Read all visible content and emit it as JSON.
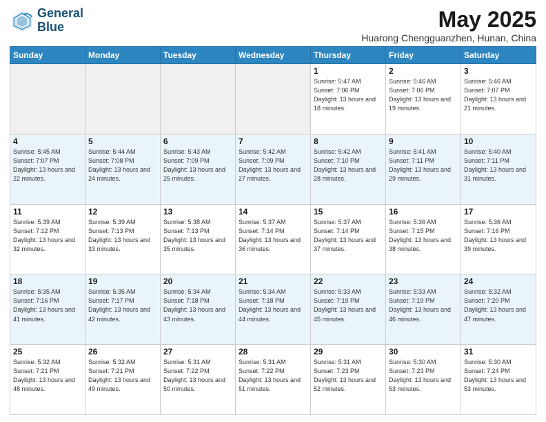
{
  "logo": {
    "line1": "General",
    "line2": "Blue"
  },
  "title": "May 2025",
  "location": "Huarong Chengguanzhen, Hunan, China",
  "weekdays": [
    "Sunday",
    "Monday",
    "Tuesday",
    "Wednesday",
    "Thursday",
    "Friday",
    "Saturday"
  ],
  "weeks": [
    [
      {
        "day": "",
        "info": ""
      },
      {
        "day": "",
        "info": ""
      },
      {
        "day": "",
        "info": ""
      },
      {
        "day": "",
        "info": ""
      },
      {
        "day": "1",
        "info": "Sunrise: 5:47 AM\nSunset: 7:06 PM\nDaylight: 13 hours\nand 18 minutes."
      },
      {
        "day": "2",
        "info": "Sunrise: 5:46 AM\nSunset: 7:06 PM\nDaylight: 13 hours\nand 19 minutes."
      },
      {
        "day": "3",
        "info": "Sunrise: 5:46 AM\nSunset: 7:07 PM\nDaylight: 13 hours\nand 21 minutes."
      }
    ],
    [
      {
        "day": "4",
        "info": "Sunrise: 5:45 AM\nSunset: 7:07 PM\nDaylight: 13 hours\nand 22 minutes."
      },
      {
        "day": "5",
        "info": "Sunrise: 5:44 AM\nSunset: 7:08 PM\nDaylight: 13 hours\nand 24 minutes."
      },
      {
        "day": "6",
        "info": "Sunrise: 5:43 AM\nSunset: 7:09 PM\nDaylight: 13 hours\nand 25 minutes."
      },
      {
        "day": "7",
        "info": "Sunrise: 5:42 AM\nSunset: 7:09 PM\nDaylight: 13 hours\nand 27 minutes."
      },
      {
        "day": "8",
        "info": "Sunrise: 5:42 AM\nSunset: 7:10 PM\nDaylight: 13 hours\nand 28 minutes."
      },
      {
        "day": "9",
        "info": "Sunrise: 5:41 AM\nSunset: 7:11 PM\nDaylight: 13 hours\nand 29 minutes."
      },
      {
        "day": "10",
        "info": "Sunrise: 5:40 AM\nSunset: 7:11 PM\nDaylight: 13 hours\nand 31 minutes."
      }
    ],
    [
      {
        "day": "11",
        "info": "Sunrise: 5:39 AM\nSunset: 7:12 PM\nDaylight: 13 hours\nand 32 minutes."
      },
      {
        "day": "12",
        "info": "Sunrise: 5:39 AM\nSunset: 7:13 PM\nDaylight: 13 hours\nand 33 minutes."
      },
      {
        "day": "13",
        "info": "Sunrise: 5:38 AM\nSunset: 7:13 PM\nDaylight: 13 hours\nand 35 minutes."
      },
      {
        "day": "14",
        "info": "Sunrise: 5:37 AM\nSunset: 7:14 PM\nDaylight: 13 hours\nand 36 minutes."
      },
      {
        "day": "15",
        "info": "Sunrise: 5:37 AM\nSunset: 7:14 PM\nDaylight: 13 hours\nand 37 minutes."
      },
      {
        "day": "16",
        "info": "Sunrise: 5:36 AM\nSunset: 7:15 PM\nDaylight: 13 hours\nand 38 minutes."
      },
      {
        "day": "17",
        "info": "Sunrise: 5:36 AM\nSunset: 7:16 PM\nDaylight: 13 hours\nand 39 minutes."
      }
    ],
    [
      {
        "day": "18",
        "info": "Sunrise: 5:35 AM\nSunset: 7:16 PM\nDaylight: 13 hours\nand 41 minutes."
      },
      {
        "day": "19",
        "info": "Sunrise: 5:35 AM\nSunset: 7:17 PM\nDaylight: 13 hours\nand 42 minutes."
      },
      {
        "day": "20",
        "info": "Sunrise: 5:34 AM\nSunset: 7:18 PM\nDaylight: 13 hours\nand 43 minutes."
      },
      {
        "day": "21",
        "info": "Sunrise: 5:34 AM\nSunset: 7:18 PM\nDaylight: 13 hours\nand 44 minutes."
      },
      {
        "day": "22",
        "info": "Sunrise: 5:33 AM\nSunset: 7:19 PM\nDaylight: 13 hours\nand 45 minutes."
      },
      {
        "day": "23",
        "info": "Sunrise: 5:33 AM\nSunset: 7:19 PM\nDaylight: 13 hours\nand 46 minutes."
      },
      {
        "day": "24",
        "info": "Sunrise: 5:32 AM\nSunset: 7:20 PM\nDaylight: 13 hours\nand 47 minutes."
      }
    ],
    [
      {
        "day": "25",
        "info": "Sunrise: 5:32 AM\nSunset: 7:21 PM\nDaylight: 13 hours\nand 48 minutes."
      },
      {
        "day": "26",
        "info": "Sunrise: 5:32 AM\nSunset: 7:21 PM\nDaylight: 13 hours\nand 49 minutes."
      },
      {
        "day": "27",
        "info": "Sunrise: 5:31 AM\nSunset: 7:22 PM\nDaylight: 13 hours\nand 50 minutes."
      },
      {
        "day": "28",
        "info": "Sunrise: 5:31 AM\nSunset: 7:22 PM\nDaylight: 13 hours\nand 51 minutes."
      },
      {
        "day": "29",
        "info": "Sunrise: 5:31 AM\nSunset: 7:23 PM\nDaylight: 13 hours\nand 52 minutes."
      },
      {
        "day": "30",
        "info": "Sunrise: 5:30 AM\nSunset: 7:23 PM\nDaylight: 13 hours\nand 53 minutes."
      },
      {
        "day": "31",
        "info": "Sunrise: 5:30 AM\nSunset: 7:24 PM\nDaylight: 13 hours\nand 53 minutes."
      }
    ]
  ]
}
